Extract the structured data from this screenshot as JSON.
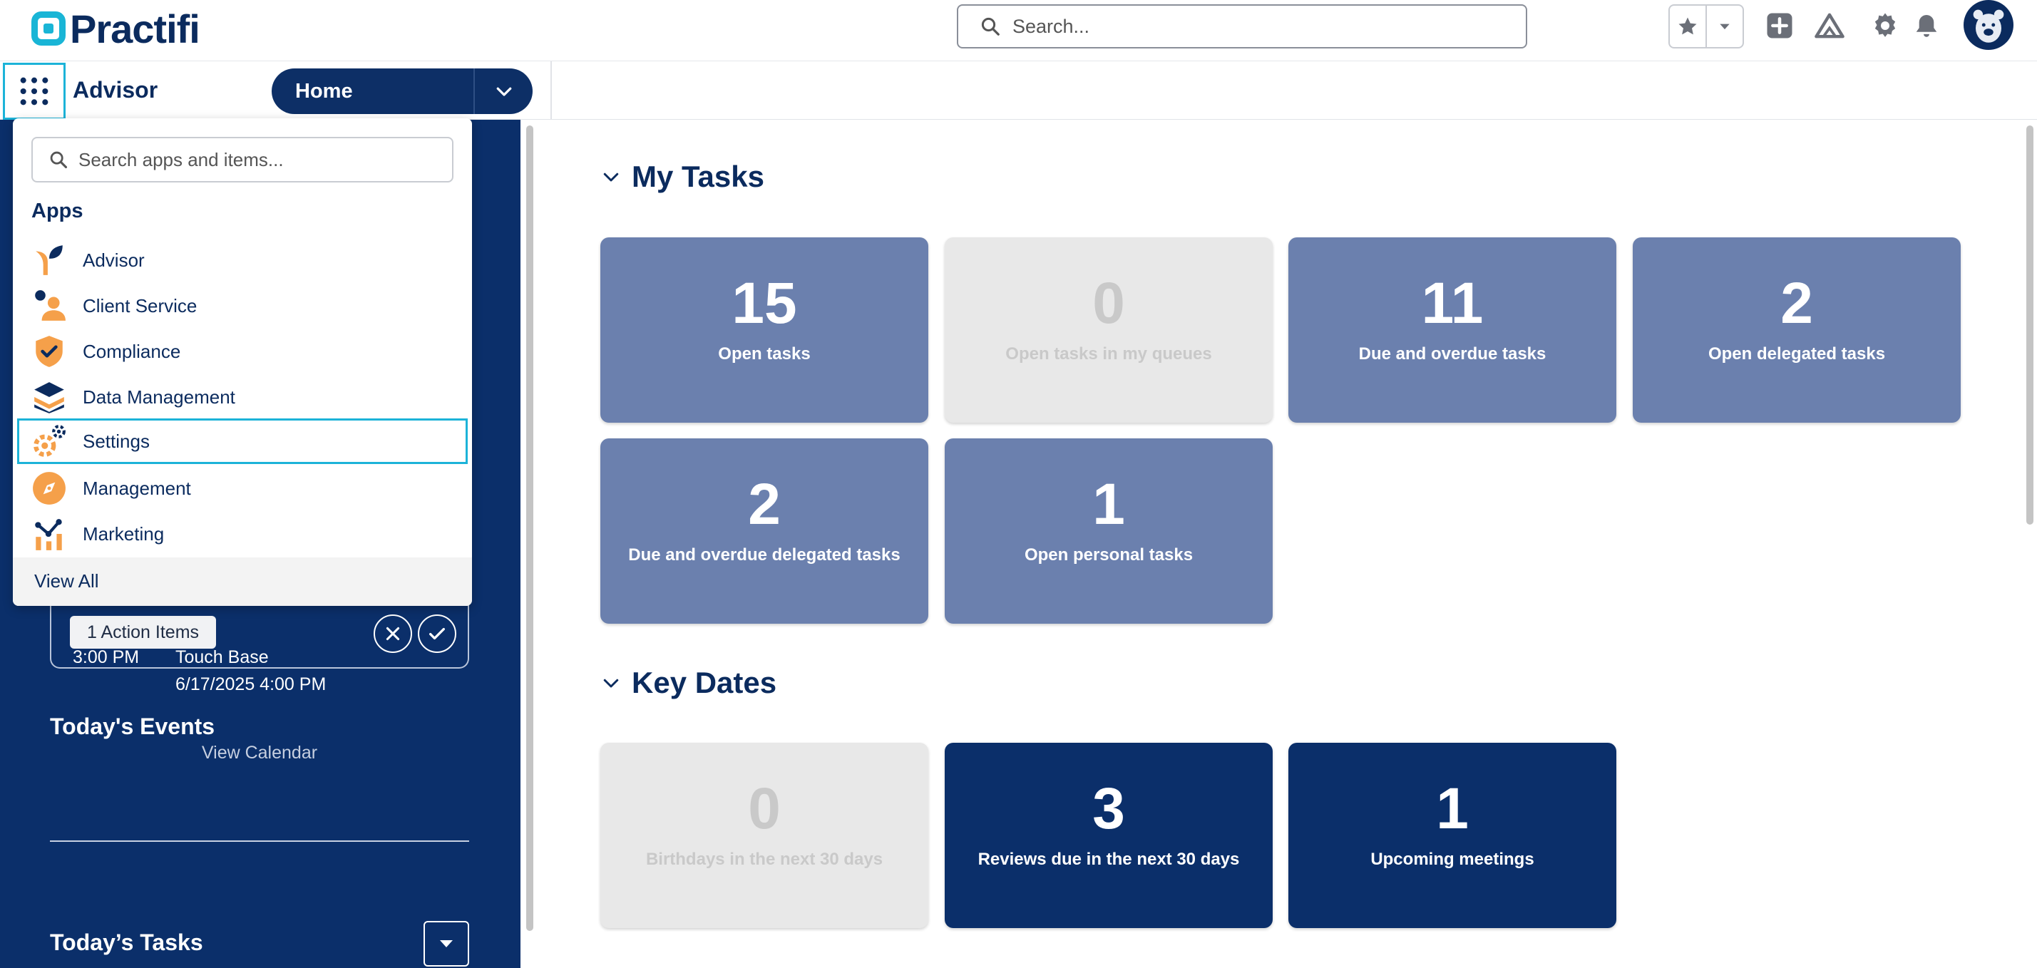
{
  "header": {
    "logo_text": "Practifi",
    "search_placeholder": "Search...",
    "icons": [
      "star-icon",
      "chevron-down-icon",
      "plus-icon",
      "trailhead-icon",
      "gear-icon",
      "bell-icon",
      "avatar"
    ]
  },
  "nav": {
    "app_name": "Advisor",
    "tab_label": "Home"
  },
  "launcher": {
    "search_placeholder": "Search apps and items...",
    "section_title": "Apps",
    "items": [
      {
        "label": "Advisor",
        "icon": "advisor-icon"
      },
      {
        "label": "Client Service",
        "icon": "client-service-icon"
      },
      {
        "label": "Compliance",
        "icon": "compliance-icon"
      },
      {
        "label": "Data Management",
        "icon": "data-management-icon"
      },
      {
        "label": "Settings",
        "icon": "settings-icon",
        "selected": true
      },
      {
        "label": "Management",
        "icon": "management-icon"
      },
      {
        "label": "Marketing",
        "icon": "marketing-icon"
      }
    ],
    "view_all": "View All"
  },
  "sidebar": {
    "action_items": "1 Action Items",
    "events_title": "Today's Events",
    "event": {
      "time": "3:00 PM",
      "title": "Touch Base",
      "datetime": "6/17/2025 4:00 PM"
    },
    "view_calendar": "View Calendar",
    "tasks_title": "Today’s Tasks"
  },
  "my_tasks": {
    "title": "My Tasks",
    "tiles": [
      {
        "value": "15",
        "label": "Open tasks",
        "style": "blue"
      },
      {
        "value": "0",
        "label": "Open tasks in my queues",
        "style": "grey"
      },
      {
        "value": "11",
        "label": "Due and overdue tasks",
        "style": "blue"
      },
      {
        "value": "2",
        "label": "Open delegated tasks",
        "style": "blue"
      },
      {
        "value": "2",
        "label": "Due and overdue delegated tasks",
        "style": "blue"
      },
      {
        "value": "1",
        "label": "Open personal tasks",
        "style": "blue"
      }
    ]
  },
  "key_dates": {
    "title": "Key Dates",
    "tiles": [
      {
        "value": "0",
        "label": "Birthdays in the next 30 days",
        "style": "grey"
      },
      {
        "value": "3",
        "label": "Reviews due in the next 30 days",
        "style": "navy"
      },
      {
        "value": "1",
        "label": "Upcoming meetings",
        "style": "navy"
      }
    ]
  },
  "colors": {
    "brand_navy": "#0b2f6a",
    "tile_blue": "#6b80ae",
    "tile_grey": "#e8e8e8",
    "accent_cyan": "#1cb3d8",
    "accent_orange": "#f5a04a"
  }
}
